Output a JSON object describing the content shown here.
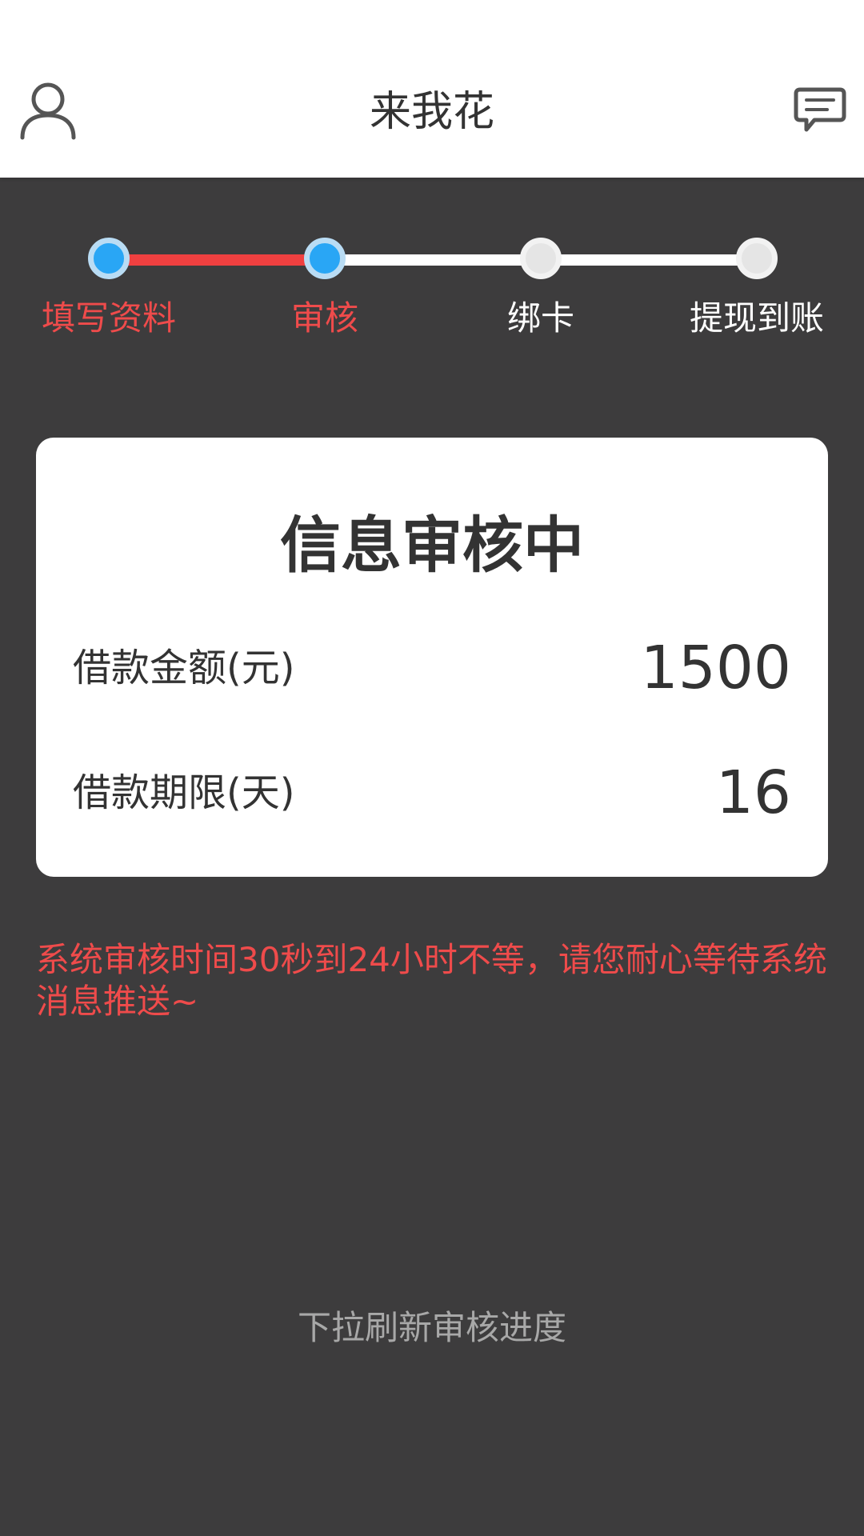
{
  "header": {
    "title": "来我花",
    "profile_icon": "user-icon",
    "message_icon": "message-icon"
  },
  "steps": [
    {
      "label": "填写资料",
      "state": "done"
    },
    {
      "label": "审核",
      "state": "current"
    },
    {
      "label": "绑卡",
      "state": "pending"
    },
    {
      "label": "提现到账",
      "state": "pending"
    }
  ],
  "card": {
    "title": "信息审核中",
    "rows": [
      {
        "label": "借款金额(元)",
        "value": "1500"
      },
      {
        "label": "借款期限(天)",
        "value": "16"
      }
    ]
  },
  "notice": "系统审核时间30秒到24小时不等，请您耐心等待系统消息推送~",
  "refresh_hint": "下拉刷新审核进度",
  "colors": {
    "accent_red": "#ef4b4b",
    "step_active": "#29a6f5",
    "background": "#3d3c3d"
  }
}
